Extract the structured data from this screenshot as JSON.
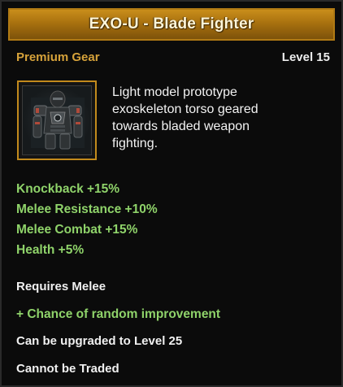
{
  "item": {
    "title": "EXO-U - Blade Fighter",
    "quality": "Premium Gear",
    "level": "Level 15",
    "icon": "exoskeleton-torso-icon",
    "description": "Light model prototype\nexoskeleton torso geared\ntowards bladed weapon\nfighting.",
    "stats": [
      "Knockback +15%",
      "Melee Resistance +10%",
      "Melee Combat +15%",
      "Health +5%"
    ],
    "requirement": "Requires Melee",
    "improvement": "+ Chance of random improvement",
    "upgrade": "Can be upgraded to Level 25",
    "trade": "Cannot be Traded"
  },
  "colors": {
    "title_bar": "#a8710f",
    "quality": "#d6a23a",
    "stat_green": "#8fd36a",
    "frame_gold": "#c28a1c",
    "background": "#0b0b0b"
  }
}
